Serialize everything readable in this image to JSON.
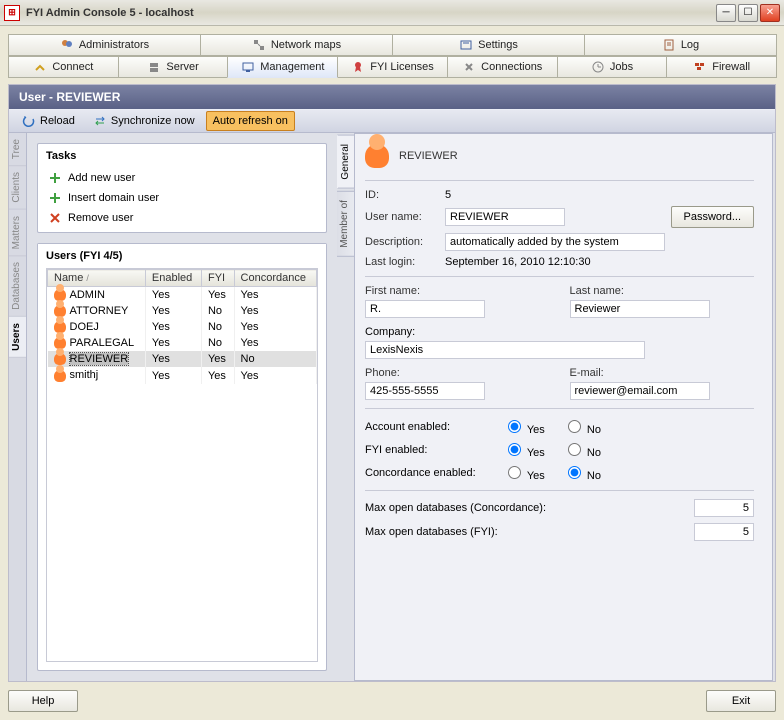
{
  "window": {
    "title": "FYI Admin Console 5 - localhost"
  },
  "toolbar_top": {
    "administrators": "Administrators",
    "network_maps": "Network maps",
    "settings": "Settings",
    "log": "Log"
  },
  "toolbar_bottom": {
    "connect": "Connect",
    "server": "Server",
    "management": "Management",
    "fyi_licenses": "FYI Licenses",
    "connections": "Connections",
    "jobs": "Jobs",
    "firewall": "Firewall"
  },
  "panel": {
    "header": "User - REVIEWER",
    "reload": "Reload",
    "sync": "Synchronize now",
    "auto_refresh": "Auto refresh on"
  },
  "left_tabs": [
    "Tree",
    "Clients",
    "Matters",
    "Databases",
    "Users"
  ],
  "tasks": {
    "title": "Tasks",
    "add": "Add new user",
    "insert": "Insert domain user",
    "remove": "Remove user"
  },
  "users_panel": {
    "title": "Users (FYI 4/5)",
    "columns": [
      "Name",
      "Enabled",
      "FYI",
      "Concordance"
    ],
    "rows": [
      {
        "name": "ADMIN",
        "enabled": "Yes",
        "fyi": "Yes",
        "conc": "Yes"
      },
      {
        "name": "ATTORNEY",
        "enabled": "Yes",
        "fyi": "No",
        "conc": "Yes"
      },
      {
        "name": "DOEJ",
        "enabled": "Yes",
        "fyi": "No",
        "conc": "Yes"
      },
      {
        "name": "PARALEGAL",
        "enabled": "Yes",
        "fyi": "No",
        "conc": "Yes"
      },
      {
        "name": "REVIEWER",
        "enabled": "Yes",
        "fyi": "Yes",
        "conc": "No"
      },
      {
        "name": "smithj",
        "enabled": "Yes",
        "fyi": "Yes",
        "conc": "Yes"
      }
    ],
    "selected_index": 4
  },
  "right_tabs": {
    "general": "General",
    "member_of": "Member of"
  },
  "form": {
    "header_name": "REVIEWER",
    "id_label": "ID:",
    "id_value": "5",
    "username_label": "User name:",
    "username_value": "REVIEWER",
    "password_btn": "Password...",
    "description_label": "Description:",
    "description_value": "automatically added by the system",
    "lastlogin_label": "Last login:",
    "lastlogin_value": "September 16, 2010 12:10:30",
    "firstname_label": "First name:",
    "firstname_value": "R.",
    "lastname_label": "Last name:",
    "lastname_value": "Reviewer",
    "company_label": "Company:",
    "company_value": "LexisNexis",
    "phone_label": "Phone:",
    "phone_value": "425-555-5555",
    "email_label": "E-mail:",
    "email_value": "reviewer@email.com",
    "account_enabled_label": "Account enabled:",
    "fyi_enabled_label": "FYI enabled:",
    "concordance_enabled_label": "Concordance enabled:",
    "yes": "Yes",
    "no": "No",
    "account_enabled": "yes",
    "fyi_enabled": "yes",
    "concordance_enabled": "no",
    "max_conc_label": "Max open databases (Concordance):",
    "max_conc_value": "5",
    "max_fyi_label": "Max open databases (FYI):",
    "max_fyi_value": "5"
  },
  "footer": {
    "help": "Help",
    "exit": "Exit"
  }
}
